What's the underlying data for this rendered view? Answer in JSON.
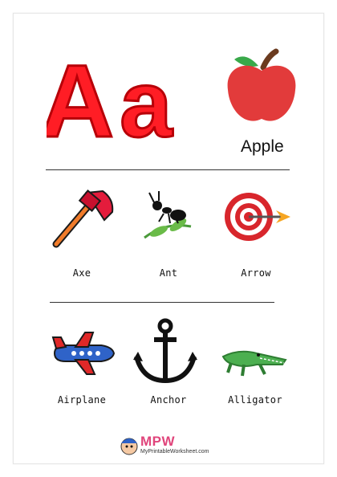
{
  "heading": {
    "uppercase": "A",
    "lowercase": "a"
  },
  "feature_word": "Apple",
  "row1": [
    {
      "label": "Axe",
      "icon": "axe-icon"
    },
    {
      "label": "Ant",
      "icon": "ant-icon"
    },
    {
      "label": "Arrow",
      "icon": "arrow-target-icon"
    }
  ],
  "row2": [
    {
      "label": "Airplane",
      "icon": "airplane-icon"
    },
    {
      "label": "Anchor",
      "icon": "anchor-icon"
    },
    {
      "label": "Alligator",
      "icon": "alligator-icon"
    }
  ],
  "footer": {
    "brand": "MPW",
    "url": "MyPrintableWorksheet.com"
  },
  "colors": {
    "letter": "#ff1d25",
    "letter_outline": "#b80008",
    "apple": "#e23b3b",
    "target": "#d8262c"
  }
}
